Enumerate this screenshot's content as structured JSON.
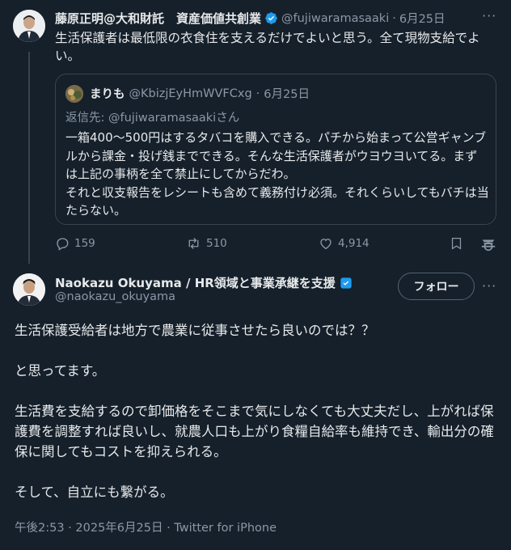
{
  "first_tweet": {
    "display_name": "藤原正明@大和財託　資産価値共創業",
    "handle": "@fujiwaramasaaki",
    "date": "6月25日",
    "text": "生活保護者は最低限の衣食住を支えるだけでよいと思う。全て現物支給でよい。",
    "quote": {
      "display_name": "まりも",
      "handle": "@KbizjEyHmWVFCxg",
      "date": "6月25日",
      "reply_to_label": "返信先: ",
      "reply_to_handle": "@fujiwaramasaaki",
      "reply_to_suffix": "さん",
      "text": "一箱400～500円はするタバコを購入できる。パチから始まって公営ギャンブルから課金・投げ銭までできる。そんな生活保護者がウヨウヨいてる。まずは上記の事柄を全て禁止にしてからだわ。\nそれと収支報告をレシートも含めて義務付け必須。それくらいしてもバチは当たらない。"
    },
    "actions": {
      "replies": "159",
      "reposts": "510",
      "likes": "4,914"
    }
  },
  "main_tweet": {
    "display_name": "Naokazu Okuyama / HR領域と事業承継を支援",
    "handle": "@naokazu_okuyama",
    "follow_label": "フォロー",
    "paragraphs": [
      "生活保護受給者は地方で農業に従事させたら良いのでは？？",
      "と思ってます。",
      "生活費を支給するので卸価格をそこまで気にしなくても大丈夫だし、上がれば保護費を調整すれば良いし、就農人口も上がり食糧自給率も維持でき、輸出分の確保に関してもコストを抑えられる。",
      "そして、自立にも繋がる。"
    ],
    "time": "午後2:53",
    "separator": "·",
    "date": "2025年6月25日",
    "source": "Twitter for iPhone"
  },
  "colors": {
    "background": "#15202b",
    "text": "#e7e9ea",
    "muted": "#8b98a5",
    "border": "#38444d",
    "verified_blue": "#1d9bf0",
    "business_gold": "#e2b719"
  },
  "icons": [
    "verified-badge-icon",
    "more-icon",
    "reply-icon",
    "repost-icon",
    "like-icon",
    "bookmark-icon",
    "grok-icon"
  ]
}
